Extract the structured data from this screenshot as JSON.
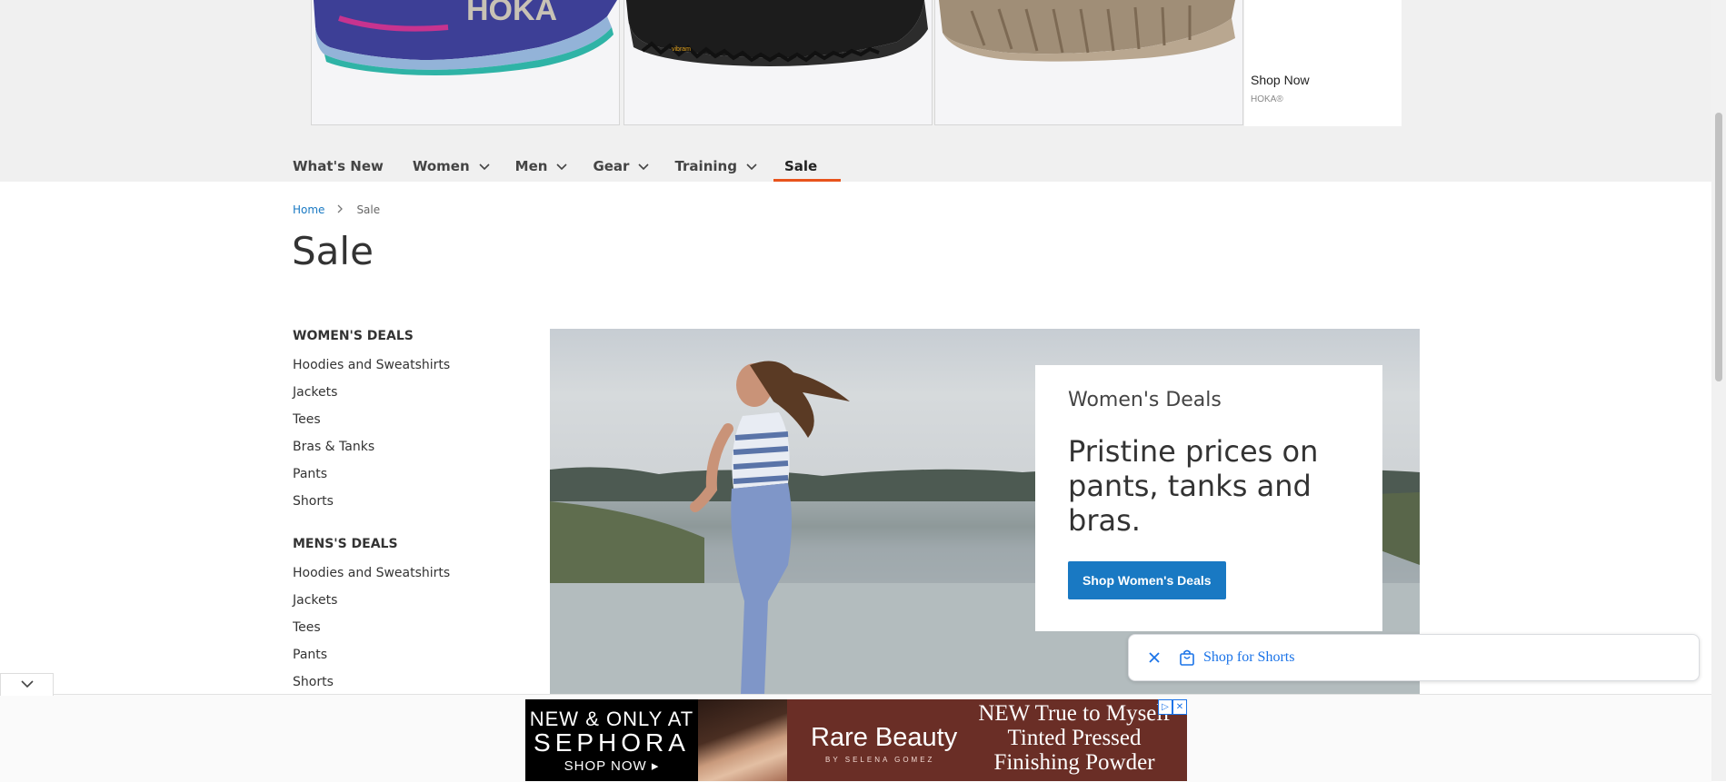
{
  "top_ad": {
    "shop_now": "Shop Now",
    "advertiser": "HOKA®",
    "brand_text": "HOKA"
  },
  "nav": {
    "items": [
      {
        "label": "What's New",
        "has_dropdown": false
      },
      {
        "label": "Women",
        "has_dropdown": true
      },
      {
        "label": "Men",
        "has_dropdown": true
      },
      {
        "label": "Gear",
        "has_dropdown": true
      },
      {
        "label": "Training",
        "has_dropdown": true
      },
      {
        "label": "Sale",
        "has_dropdown": false,
        "active": true
      }
    ],
    "active_color": "#e8531c"
  },
  "breadcrumb": {
    "home": "Home",
    "current": "Sale"
  },
  "page": {
    "title": "Sale"
  },
  "sidebar": {
    "womens": {
      "heading": "WOMEN'S DEALS",
      "items": [
        "Hoodies and Sweatshirts",
        "Jackets",
        "Tees",
        "Bras & Tanks",
        "Pants",
        "Shorts"
      ]
    },
    "mens": {
      "heading": "MENS'S DEALS",
      "items": [
        "Hoodies and Sweatshirts",
        "Jackets",
        "Tees",
        "Pants",
        "Shorts"
      ]
    }
  },
  "promo": {
    "eyebrow": "Women's Deals",
    "headline": "Pristine prices on pants, tanks and bras.",
    "button": "Shop Women's Deals",
    "button_color": "#1979c3"
  },
  "shopping_chip": {
    "label": "Shop for Shorts",
    "close_icon": "close-icon",
    "bag_icon": "shopping-bag-icon"
  },
  "bottom_ad": {
    "left_line1": "NEW & ONLY AT",
    "left_line2": "SEPHORA",
    "left_line3": "SHOP NOW ▸",
    "brand": "Rare Beauty",
    "brand_sub": "BY SELENA GOMEZ",
    "right_line1": "NEW True to Myself",
    "right_line2": "Tinted Pressed",
    "right_line3": "Finishing Powder"
  }
}
